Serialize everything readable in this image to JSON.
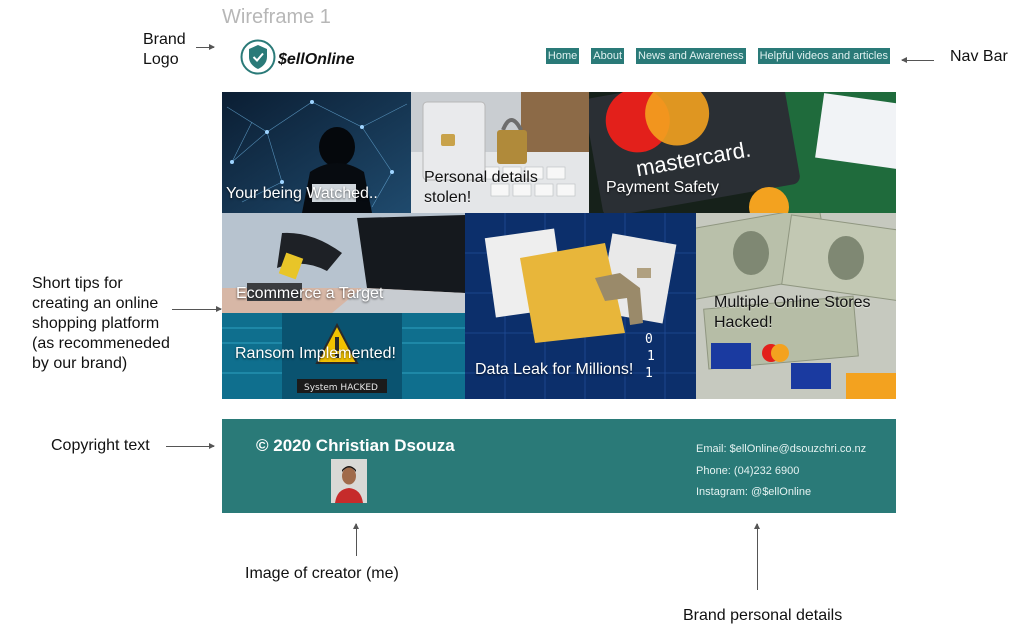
{
  "wireframe_title": "Wireframe 1",
  "annotations": {
    "brand_logo": "Brand\nLogo",
    "nav_bar": "Nav Bar",
    "short_tips": "Short tips for\ncreating an online\nshopping platform\n(as recommeneded\nby our brand)",
    "copyright_text": "Copyright text",
    "image_of_creator": "Image of creator (me)",
    "brand_personal_details": "Brand personal details"
  },
  "brand": {
    "name": "$ellOnline"
  },
  "nav": [
    {
      "label": "Home"
    },
    {
      "label": "About"
    },
    {
      "label": "News and Awareness"
    },
    {
      "label": "Helpful videos and articles"
    }
  ],
  "tiles": [
    {
      "caption": "Your being Watched.."
    },
    {
      "caption": "Personal details\nstolen!"
    },
    {
      "caption": "Payment Safety",
      "brand_text": "mastercard."
    },
    {
      "caption": "Ecommerce a Target"
    },
    {
      "caption": "Data Leak for Millions!"
    },
    {
      "caption": "Multiple Online Stores\nHacked!"
    },
    {
      "caption": "Ransom Implemented!",
      "screen_text": "System HACKED"
    }
  ],
  "footer": {
    "copyright": "© 2020 Christian Dsouza",
    "email": "Email: $ellOnline@dsouzchri.co.nz",
    "phone": "Phone: (04)232 6900",
    "instagram": "Instagram: @$ellOnline"
  },
  "colors": {
    "brand_teal": "#2a7a78",
    "nav_text": "#dff1f0"
  },
  "icons": [
    "shield-check-icon"
  ]
}
